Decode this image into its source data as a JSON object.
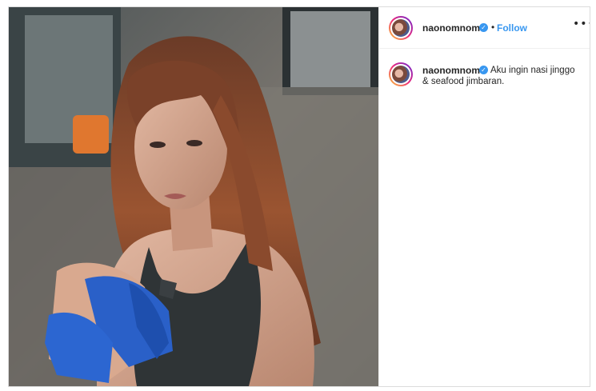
{
  "post": {
    "photo": {
      "alt": "photo"
    },
    "header": {
      "username": "naonomnom",
      "verified_glyph": "✓",
      "separator": "•",
      "follow_label": "Follow",
      "more_glyph": "•••"
    },
    "caption": {
      "username": "naonomnom",
      "verified_glyph": "✓",
      "text_line1": "Aku ingin nasi jinggo",
      "text_line2": "& seafood jimbaran."
    }
  },
  "colors": {
    "accent": "#3897f0",
    "text": "#262626",
    "border": "#dbdbdb"
  }
}
